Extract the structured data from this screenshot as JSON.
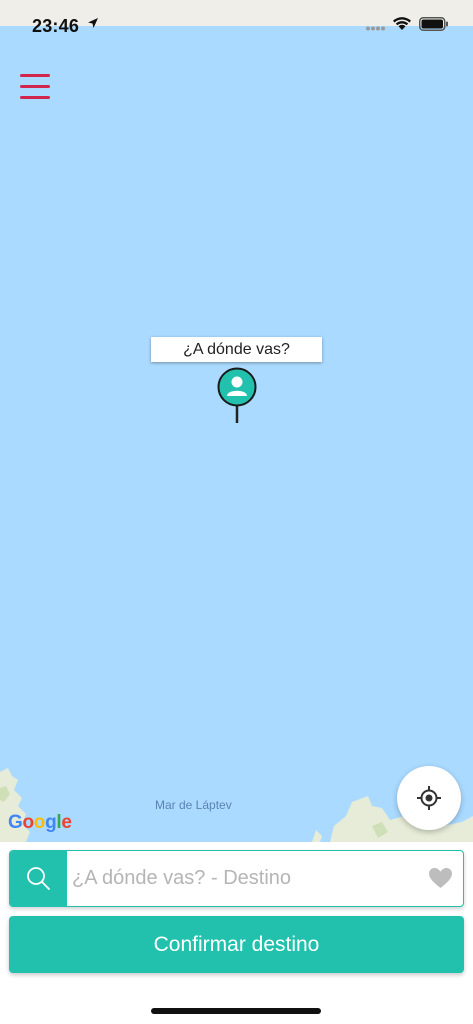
{
  "status_bar": {
    "time": "23:46"
  },
  "map": {
    "pin_label": "¿A dónde vas?",
    "sea_label": "Mar de Láptev",
    "logo": {
      "G": "G",
      "o1": "o",
      "o2": "o",
      "g": "g",
      "l": "l",
      "e": "e"
    }
  },
  "search": {
    "placeholder": "¿A dónde vas? - Destino",
    "value": ""
  },
  "confirm_button": {
    "label": "Confirmar destino"
  },
  "icons": {
    "menu": "hamburger-menu-icon",
    "pin": "user-pin-icon",
    "locate": "crosshair-locate-icon",
    "search": "search-icon",
    "favorite": "heart-icon"
  },
  "colors": {
    "accent": "#21c1ae",
    "menu": "#d2254c",
    "water": "#aadaff"
  }
}
